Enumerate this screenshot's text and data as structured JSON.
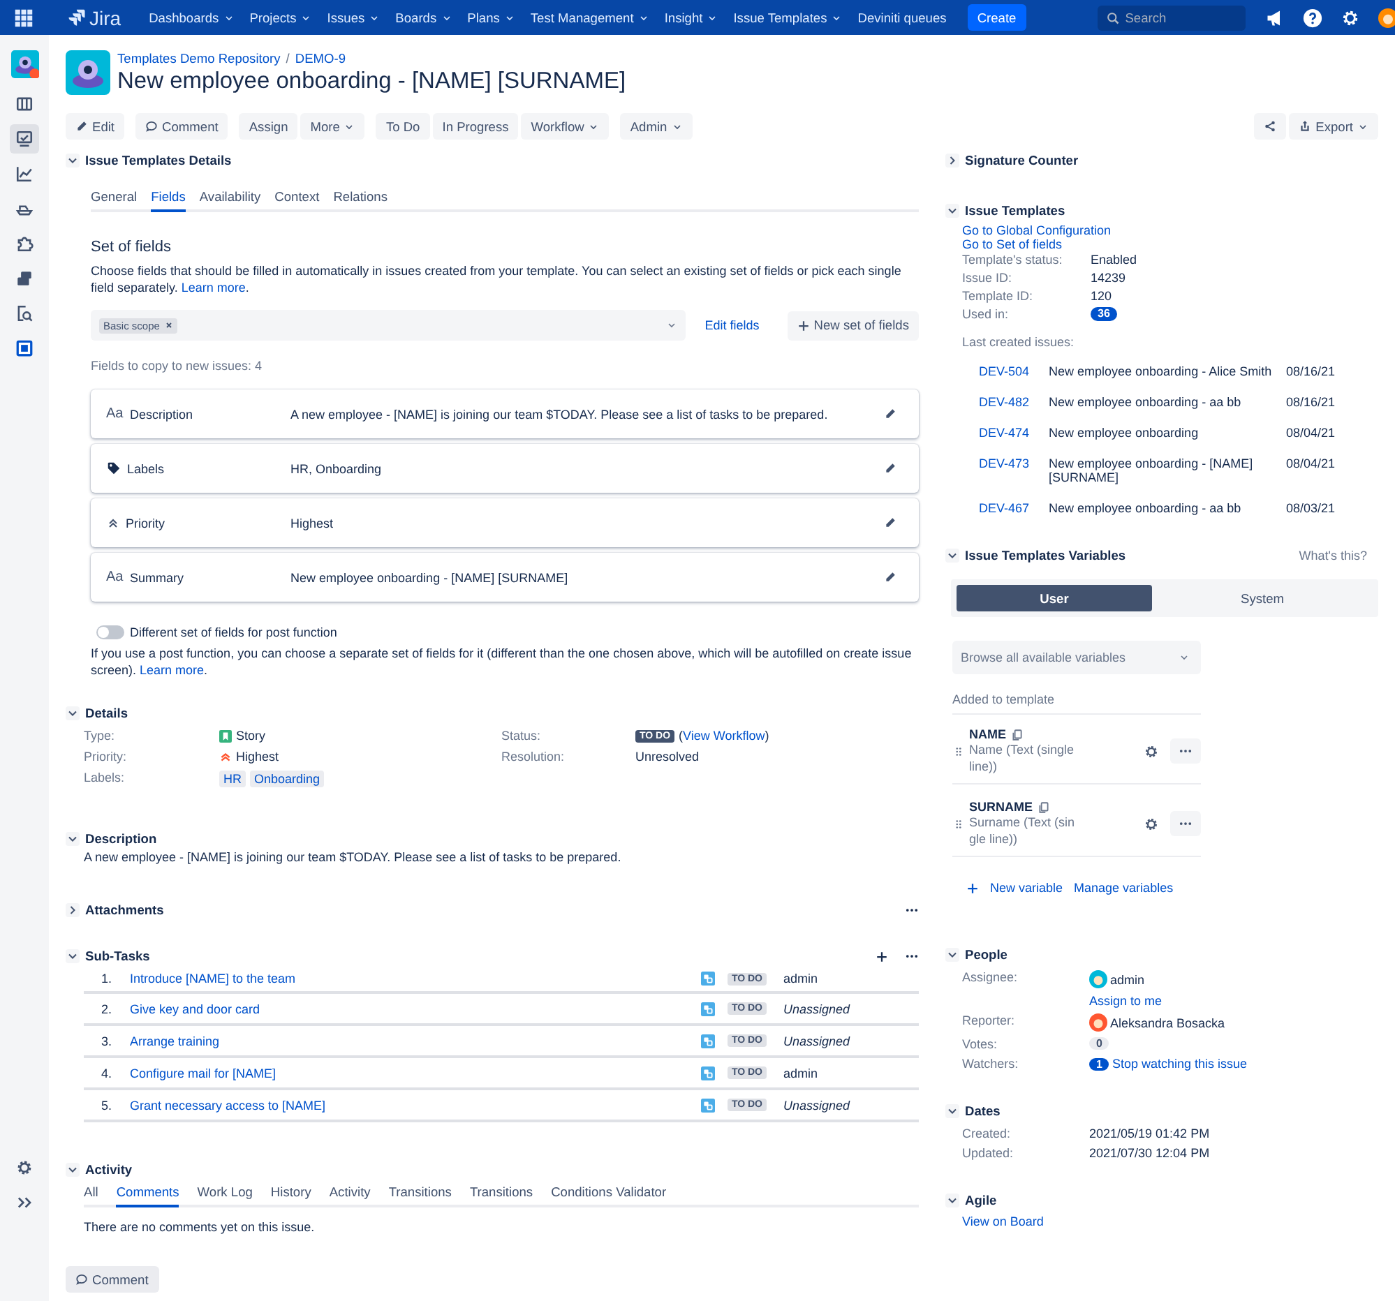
{
  "top_nav": {
    "product": "Jira",
    "menus": [
      {
        "label": "Dashboards",
        "dropdown": true
      },
      {
        "label": "Projects",
        "dropdown": true
      },
      {
        "label": "Issues",
        "dropdown": true
      },
      {
        "label": "Boards",
        "dropdown": true
      },
      {
        "label": "Plans",
        "dropdown": true
      },
      {
        "label": "Test Management",
        "dropdown": true
      },
      {
        "label": "Insight",
        "dropdown": true
      },
      {
        "label": "Issue Templates",
        "dropdown": true
      },
      {
        "label": "Deviniti queues",
        "dropdown": false
      }
    ],
    "create_button": "Create",
    "search": {
      "placeholder": "Search"
    }
  },
  "sidebar": {
    "items": [
      {
        "kind": "project",
        "selected": false
      },
      {
        "kind": "board",
        "selected": false
      },
      {
        "kind": "monitor",
        "selected": true
      },
      {
        "kind": "chart",
        "selected": false
      },
      {
        "kind": "ship",
        "selected": false
      },
      {
        "kind": "puzzle",
        "selected": false
      },
      {
        "kind": "stack",
        "selected": false
      },
      {
        "kind": "search-doc",
        "selected": false
      },
      {
        "kind": "app",
        "selected": false
      }
    ],
    "footer_items": [
      {
        "kind": "settings",
        "selected": false
      },
      {
        "kind": "expand",
        "selected": false
      }
    ]
  },
  "breadcrumbs": [
    "Templates Demo Repository",
    "DEMO-9"
  ],
  "breadcrumb_separator": "/",
  "issue_title": "New employee onboarding - [NAME] [SURNAME]",
  "toolbar": {
    "groups": [
      [
        {
          "label": "Edit",
          "kind": "edit",
          "dropdown": false
        }
      ],
      [
        {
          "label": "Comment",
          "kind": "comment",
          "dropdown": false
        }
      ],
      [
        {
          "label": "Assign",
          "kind": "plain",
          "dropdown": false
        },
        {
          "label": "More",
          "kind": "plain",
          "dropdown": true
        }
      ],
      [
        {
          "label": "To Do",
          "kind": "plain",
          "dropdown": false
        },
        {
          "label": "In Progress",
          "kind": "plain",
          "dropdown": false
        },
        {
          "label": "Workflow",
          "kind": "plain",
          "dropdown": true
        }
      ],
      [
        {
          "label": "Admin",
          "kind": "plain",
          "dropdown": true
        }
      ]
    ],
    "right": [
      {
        "kind": "share",
        "dropdown": false
      },
      {
        "label": "Export",
        "kind": "export",
        "dropdown": true
      }
    ]
  },
  "templates_details": {
    "title": "Issue Templates Details",
    "expanded": true,
    "tabs": [
      {
        "label": "General",
        "selected": false
      },
      {
        "label": "Fields",
        "selected": true
      },
      {
        "label": "Availability",
        "selected": false
      },
      {
        "label": "Context",
        "selected": false
      },
      {
        "label": "Relations",
        "selected": false
      }
    ],
    "heading": "Set of fields",
    "description": {
      "text": "Choose fields that should be filled in automatically in issues created from your template. You can select an existing set of fields or pick each single field separately.",
      "link": "Learn more",
      "after": "."
    },
    "select_tags": [
      "Basic scope"
    ],
    "edit_fields": "Edit fields",
    "new_set_button": "New set of fields",
    "fields_count": "Fields to copy to new issues: 4",
    "fields": [
      {
        "kind": "text",
        "glyph": "Aa",
        "name": "Description",
        "value": "A new employee - [NAME] is joining our team $TODAY. Please see a list of tasks to be prepared."
      },
      {
        "kind": "labels",
        "name": "Labels",
        "value": "HR, Onboarding"
      },
      {
        "kind": "priority",
        "name": "Priority",
        "value": "Highest"
      },
      {
        "kind": "text",
        "glyph": "Aa",
        "name": "Summary",
        "value": "New employee onboarding - [NAME] [SURNAME]"
      }
    ],
    "post_function": {
      "on": false,
      "label": "Different set of fields for post function",
      "note": "If you use a post function, you can choose a separate set of fields for it (different than the one chosen above, which will be autofilled on create issue screen).",
      "link": "Learn more",
      "after": "."
    }
  },
  "details": {
    "title": "Details",
    "expanded": true,
    "left": [
      {
        "label": "Type:",
        "kind": "type",
        "value": "Story"
      },
      {
        "label": "Priority:",
        "kind": "priority",
        "value": "Highest"
      },
      {
        "label": "Labels:",
        "kind": "labels",
        "values": [
          "HR",
          "Onboarding"
        ]
      }
    ],
    "right": [
      {
        "label": "Status:",
        "kind": "status",
        "badge": "TO DO",
        "before": "(",
        "link": "View Workflow",
        "after": ")"
      },
      {
        "label": "Resolution:",
        "kind": "text",
        "value": "Unresolved"
      }
    ]
  },
  "description": {
    "title": "Description",
    "expanded": true,
    "text": "A new employee - [NAME] is joining our team $TODAY. Please see a list of tasks to be prepared."
  },
  "attachments": {
    "title": "Attachments",
    "expanded": false
  },
  "subtasks": {
    "title": "Sub-Tasks",
    "expanded": true,
    "rows": [
      {
        "number": "1.",
        "title": "Introduce [NAME] to the team",
        "status": "TO DO",
        "assignee": "admin",
        "unassigned": false
      },
      {
        "number": "2.",
        "title": "Give key and door card",
        "status": "TO DO",
        "assignee": "Unassigned",
        "unassigned": true
      },
      {
        "number": "3.",
        "title": "Arrange training",
        "status": "TO DO",
        "assignee": "Unassigned",
        "unassigned": true
      },
      {
        "number": "4.",
        "title": "Configure mail for [NAME]",
        "status": "TO DO",
        "assignee": "admin",
        "unassigned": false
      },
      {
        "number": "5.",
        "title": "Grant necessary access to [NAME]",
        "status": "TO DO",
        "assignee": "Unassigned",
        "unassigned": true
      }
    ]
  },
  "activity": {
    "title": "Activity",
    "expanded": true,
    "tabs": [
      {
        "label": "All",
        "selected": false
      },
      {
        "label": "Comments",
        "selected": true
      },
      {
        "label": "Work Log",
        "selected": false
      },
      {
        "label": "History",
        "selected": false
      },
      {
        "label": "Activity",
        "selected": false
      },
      {
        "label": "Transitions",
        "selected": false
      },
      {
        "label": "Transitions",
        "selected": false
      },
      {
        "label": "Conditions Validator",
        "selected": false
      }
    ],
    "empty": "There are no comments yet on this issue.",
    "comment_button": "Comment"
  },
  "signature_counter": {
    "title": "Signature Counter",
    "expanded": false
  },
  "issue_templates": {
    "title": "Issue Templates",
    "expanded": true,
    "links": [
      "Go to Global Configuration",
      "Go to Set of fields"
    ],
    "props": [
      {
        "label": "Template's status:",
        "value": "Enabled",
        "kind": "text"
      },
      {
        "label": "Issue ID:",
        "value": "14239",
        "kind": "text"
      },
      {
        "label": "Template ID:",
        "value": "120",
        "kind": "text"
      },
      {
        "label": "Used in:",
        "value": "36",
        "kind": "badge"
      }
    ],
    "last_created_label": "Last created issues:",
    "last_created": [
      {
        "key": "DEV-504",
        "summary": "New employee onboarding - Alice Smith",
        "date": "08/16/21"
      },
      {
        "key": "DEV-482",
        "summary": "New employee onboarding - aa bb",
        "date": "08/16/21"
      },
      {
        "key": "DEV-474",
        "summary": "New employee onboarding",
        "date": "08/04/21"
      },
      {
        "key": "DEV-473",
        "summary": "New employee onboarding - [NAME] [SURNAME]",
        "date": "08/04/21"
      },
      {
        "key": "DEV-467",
        "summary": "New employee onboarding - aa bb",
        "date": "08/03/21"
      }
    ]
  },
  "variables": {
    "title": "Issue Templates Variables",
    "expanded": true,
    "help": "What's this?",
    "tabs": [
      {
        "label": "User",
        "selected": true
      },
      {
        "label": "System",
        "selected": false
      }
    ],
    "browse": {
      "placeholder": "Browse all available variables"
    },
    "added_label": "Added to template",
    "items": [
      {
        "name": "NAME",
        "type": "Name (Text (single line))"
      },
      {
        "name": "SURNAME",
        "type": "Surname (Text (single line))"
      }
    ],
    "new_variable": "New variable",
    "manage": "Manage variables"
  },
  "people": {
    "title": "People",
    "expanded": true,
    "rows": [
      {
        "label": "Assignee:",
        "kind": "user",
        "value": "admin",
        "link": "Assign to me"
      },
      {
        "label": "Reporter:",
        "kind": "user",
        "value": "Aleksandra Bosacka"
      },
      {
        "label": "Votes:",
        "kind": "count",
        "value": "0"
      },
      {
        "label": "Watchers:",
        "kind": "watch",
        "value": "1",
        "link": "Stop watching this issue"
      }
    ]
  },
  "dates": {
    "title": "Dates",
    "expanded": true,
    "rows": [
      {
        "label": "Created:",
        "value": "2021/05/19 01:42 PM"
      },
      {
        "label": "Updated:",
        "value": "2021/07/30 12:04 PM"
      }
    ]
  },
  "agile": {
    "title": "Agile",
    "expanded": true,
    "link": "View on Board"
  }
}
